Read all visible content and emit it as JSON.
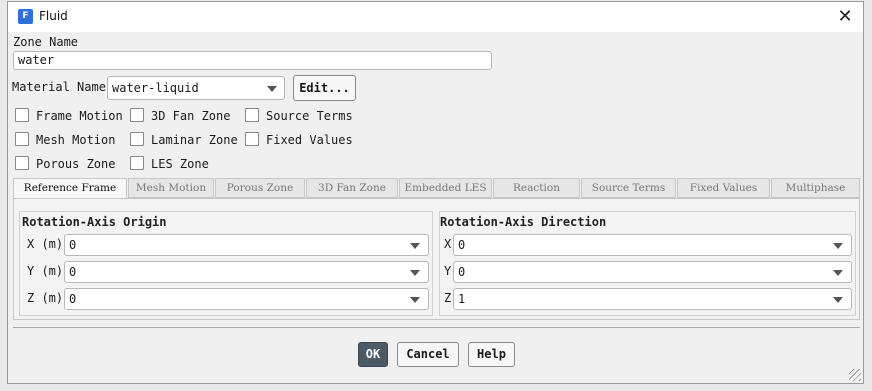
{
  "window": {
    "title": "Fluid",
    "icon_letter": "F"
  },
  "zone_name": {
    "label": "Zone Name",
    "value": "water"
  },
  "material": {
    "label": "Material Name",
    "value": "water-liquid",
    "edit_label": "Edit..."
  },
  "checkboxes": [
    {
      "label": "Frame Motion",
      "checked": false
    },
    {
      "label": "3D Fan Zone",
      "checked": false
    },
    {
      "label": "Source Terms",
      "checked": false
    },
    {
      "label": "Mesh Motion",
      "checked": false
    },
    {
      "label": "Laminar Zone",
      "checked": false
    },
    {
      "label": "Fixed Values",
      "checked": false
    },
    {
      "label": "Porous Zone",
      "checked": false
    },
    {
      "label": "LES Zone",
      "checked": false
    }
  ],
  "tabs": [
    {
      "label": "Reference Frame",
      "active": true
    },
    {
      "label": "Mesh Motion",
      "active": false
    },
    {
      "label": "Porous Zone",
      "active": false
    },
    {
      "label": "3D Fan Zone",
      "active": false
    },
    {
      "label": "Embedded LES",
      "active": false
    },
    {
      "label": "Reaction",
      "active": false
    },
    {
      "label": "Source Terms",
      "active": false
    },
    {
      "label": "Fixed Values",
      "active": false
    },
    {
      "label": "Multiphase",
      "active": false
    }
  ],
  "origin": {
    "title": "Rotation-Axis Origin",
    "fields": [
      {
        "label": "X (m)",
        "value": "0"
      },
      {
        "label": "Y (m)",
        "value": "0"
      },
      {
        "label": "Z (m)",
        "value": "0"
      }
    ]
  },
  "direction": {
    "title": "Rotation-Axis Direction",
    "fields": [
      {
        "label": "X",
        "value": "0"
      },
      {
        "label": "Y",
        "value": "0"
      },
      {
        "label": "Z",
        "value": "1"
      }
    ]
  },
  "buttons": {
    "ok": "OK",
    "cancel": "Cancel",
    "help": "Help"
  },
  "colors": {
    "primary_button": "#4c5a66",
    "app_icon": "#2f6fd6"
  }
}
